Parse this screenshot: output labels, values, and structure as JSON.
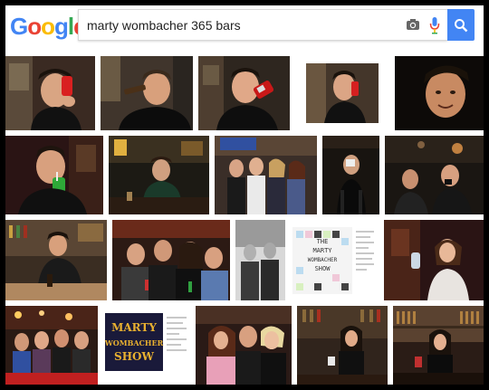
{
  "logo": {
    "letters": [
      "G",
      "o",
      "o",
      "g",
      "l",
      "e"
    ],
    "colors": [
      "#4285f4",
      "#ea4335",
      "#fbbc05",
      "#4285f4",
      "#34a853",
      "#ea4335"
    ]
  },
  "search": {
    "query": "marty wombacher 365 bars",
    "camera_icon": "camera-icon",
    "mic_icon": "microphone-icon",
    "button_icon": "magnifier-icon",
    "button_color": "#4285f4"
  },
  "results": {
    "rows": [
      [
        {
          "name": "result-man-drinking-soda-can-1",
          "bg": "#3a2a22"
        },
        {
          "name": "result-man-drinking-beer-bottle",
          "bg": "#40352c"
        },
        {
          "name": "result-man-drinking-soda-can-2",
          "bg": "#2e261f"
        },
        {
          "name": "result-man-holding-soda-can",
          "bg": "#ffffff"
        },
        {
          "name": "result-man-closeup-dark",
          "bg": "#0d0a08"
        }
      ],
      [
        {
          "name": "result-man-drinking-straw",
          "bg": "#2a1414"
        },
        {
          "name": "result-man-at-bar-counter",
          "bg": "#1c1a14"
        },
        {
          "name": "result-group-with-women",
          "bg": "#3a2e28"
        },
        {
          "name": "result-man-drinking-dark-bar",
          "bg": "#181410"
        },
        {
          "name": "result-men-at-dark-bar",
          "bg": "#1a1612"
        }
      ],
      [
        {
          "name": "result-man-behind-bar",
          "bg": "#3a2d22"
        },
        {
          "name": "result-group-selfie",
          "bg": "#2c1a14"
        },
        {
          "name": "result-black-white-photo",
          "bg": "#d8d8d8"
        },
        {
          "name": "result-marty-wombacher-show-poster",
          "bg": "#ffffff"
        },
        {
          "name": "result-woman-holding-drink",
          "bg": "#2a1414"
        }
      ],
      [
        {
          "name": "result-group-outdoor-lights",
          "bg": "#2a1a14"
        },
        {
          "name": "result-marty-wombacher-show-logo",
          "bg": "#ffffff"
        },
        {
          "name": "result-three-people-smiling",
          "bg": "#2a1a16"
        },
        {
          "name": "result-bartender-woman-1",
          "bg": "#30241c"
        },
        {
          "name": "result-bartender-woman-2",
          "bg": "#2a1c16"
        }
      ]
    ],
    "poster_text": [
      "THE",
      "MARTY",
      "WOMBACHER",
      "SHOW"
    ],
    "logo_text": [
      "MARTY",
      "WOMBACHER",
      "SHOW"
    ]
  }
}
